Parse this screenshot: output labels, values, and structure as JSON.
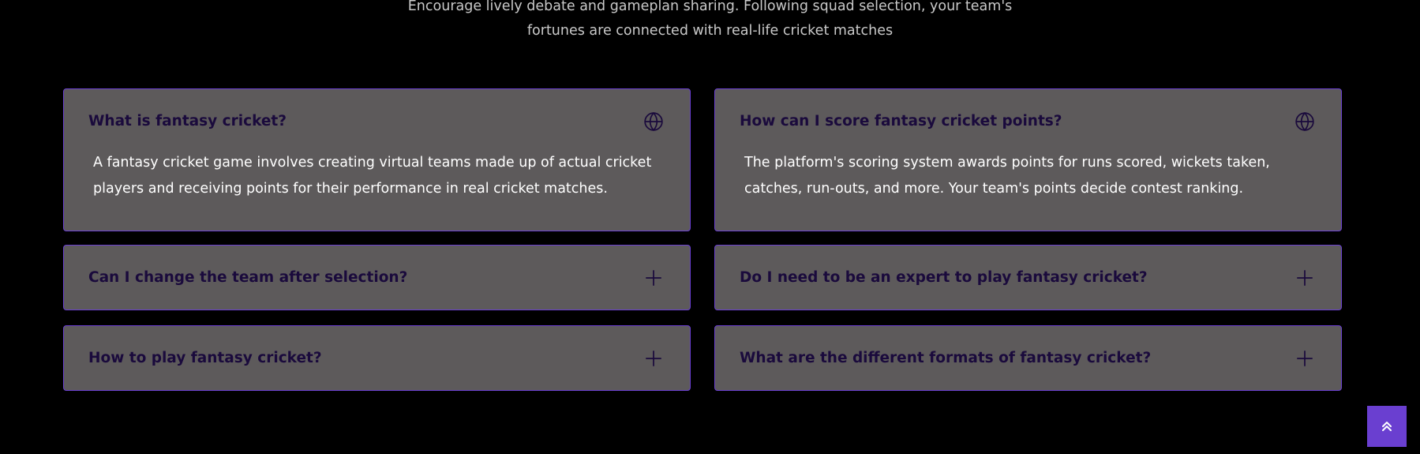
{
  "intro": {
    "line1": "Encourage lively debate and gameplan sharing. Following squad selection, your team's",
    "line2": "fortunes are connected with real-life cricket matches"
  },
  "faqs": [
    {
      "question": "What is fantasy cricket?",
      "expanded": true,
      "icon": "globe-icon",
      "answer_line1": "A fantasy cricket game involves creating virtual teams made up of actual cricket",
      "answer_line2": "players and receiving points for their performance in real cricket matches."
    },
    {
      "question": "How can I score fantasy cricket points?",
      "expanded": true,
      "icon": "globe-icon",
      "answer_line1": "The platform's scoring system awards points for runs scored, wickets taken,",
      "answer_line2": "catches, run-outs, and more. Your team's points decide contest ranking."
    },
    {
      "question": "Can I change the team after selection?",
      "expanded": false,
      "icon": "plus-icon"
    },
    {
      "question": "Do I need to be an expert to play fantasy cricket?",
      "expanded": false,
      "icon": "plus-icon"
    },
    {
      "question": "How to play fantasy cricket?",
      "expanded": false,
      "icon": "plus-icon"
    },
    {
      "question": "What are the different formats of fantasy cricket?",
      "expanded": false,
      "icon": "plus-icon"
    }
  ],
  "scroll_top": {
    "icon": "double-chevron-up-icon"
  },
  "colors": {
    "background": "#000000",
    "card_background": "#5d5a5b",
    "card_border": "#6a3fd0",
    "question_text": "#1a0a3c",
    "answer_text": "#ffffff",
    "intro_text": "#c9c9c9",
    "accent": "#6a3fd0"
  }
}
